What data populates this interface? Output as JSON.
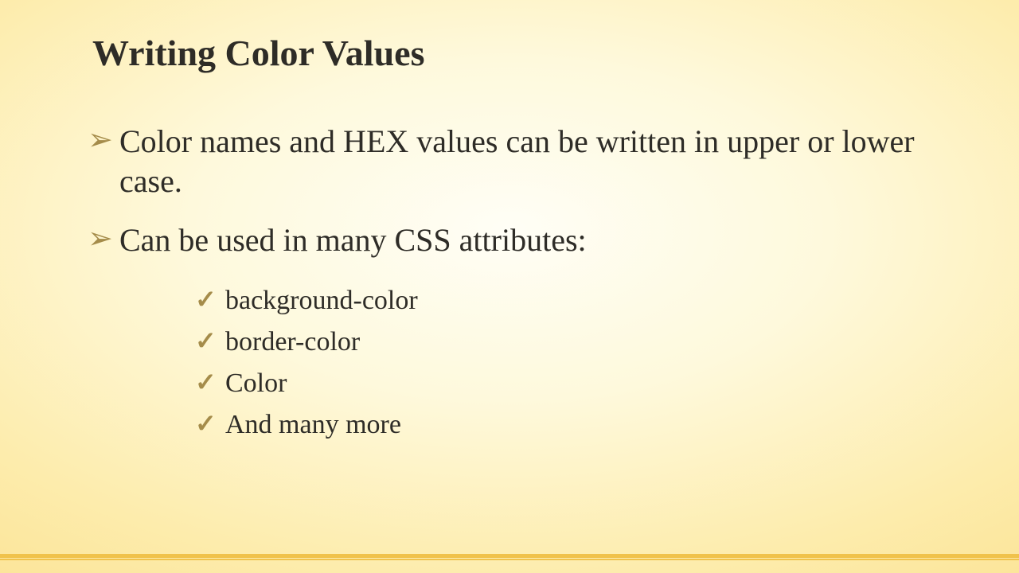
{
  "title": "Writing Color Values",
  "bullets": {
    "b1": "Color names and HEX values can be written in upper or lower case.",
    "b2": "Can be used in many CSS attributes:",
    "sub": {
      "s1": "background-color",
      "s2": "border-color",
      "s3": "Color",
      "s4": "And many more"
    }
  }
}
